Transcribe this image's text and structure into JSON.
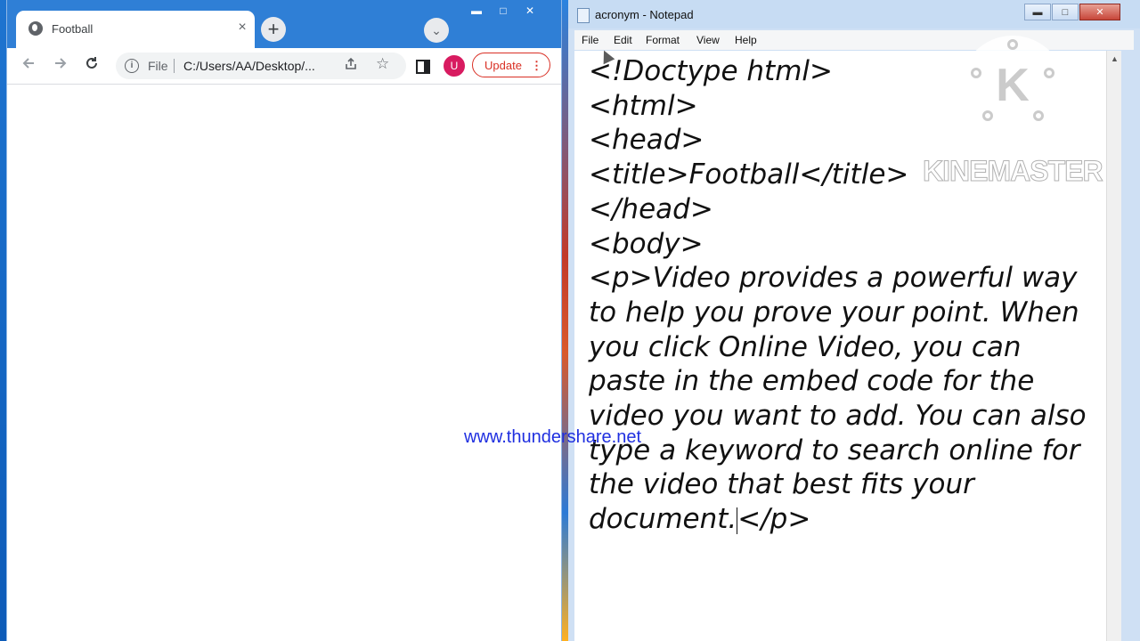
{
  "browser": {
    "tab_title": "Football",
    "tab_close": "×",
    "new_tab": "+",
    "tab_search": "⌄",
    "scheme_label": "File",
    "url": "C:/Users/AA/Desktop/...",
    "avatar_initial": "U",
    "update_label": "Update",
    "update_menu": "⋮",
    "win_minimize": "▬",
    "win_maximize": "□",
    "win_close": "✕",
    "icons": [
      "back-icon",
      "forward-icon",
      "reload-icon",
      "info-icon",
      "share-icon",
      "star-icon",
      "side-panel-icon"
    ]
  },
  "notepad": {
    "title": "acronym - Notepad",
    "menu": [
      "File",
      "Edit",
      "Format",
      "View",
      "Help"
    ],
    "btn_minimize": "▬",
    "btn_maximize": "□",
    "btn_close": "✕",
    "scroll_up": "▲",
    "content_before_cursor": "<!Doctype html>\n<html>\n<head>\n<title>Football</title>\n</head>\n<body>\n<p>Video provides a powerful way to help you prove your point. When you click Online Video, you can paste in the embed code for the video you want to add. You can also type a keyword to search online for the video that best fits your document.",
    "content_after_cursor": "</p>"
  },
  "overlays": {
    "kinemaster_letter": "K",
    "kinemaster_text": "KINEMASTER",
    "site_watermark": "www.thundershare.net"
  },
  "colors": {
    "desktop_blue": "#1e74d0",
    "chrome_tabbar": "#2f7fd6",
    "update_red": "#d93025",
    "avatar_pink": "#d81b60",
    "watermark_blue": "#1f2fe0"
  }
}
